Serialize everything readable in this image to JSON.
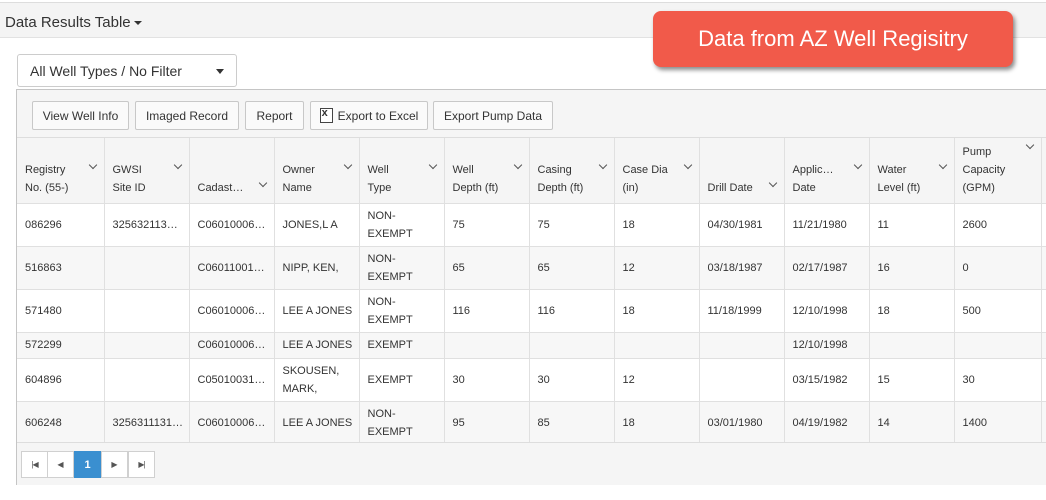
{
  "panel": {
    "title": "Data Results Table"
  },
  "callout": {
    "text": "Data from AZ Well Regisitry",
    "color": "#f15a4a"
  },
  "filter": {
    "selected": "All Well Types / No Filter"
  },
  "toolbar": {
    "view_well_info": "View Well Info",
    "imaged_record": "Imaged Record",
    "report": "Report",
    "export_excel": "Export to Excel",
    "export_pump": "Export Pump Data"
  },
  "columns": [
    "Registry\nNo. (55-)",
    "GWSI\nSite ID",
    "Cadast…",
    "Owner\nName",
    "Well\nType",
    "Well\nDepth (ft)",
    "Casing\nDepth (ft)",
    "Case Dia\n(in)",
    "Drill Date",
    "Applic…\nDate",
    "Water\nLevel (ft)",
    "Pump\nCapacity\n(GPM)"
  ],
  "rows": [
    [
      "086296",
      "325632113…",
      "C06010006…",
      "JONES,L A",
      "NON-\nEXEMPT",
      "75",
      "75",
      "18",
      "04/30/1981",
      "11/21/1980",
      "11",
      "2600"
    ],
    [
      "516863",
      "",
      "C06011001…",
      "NIPP, KEN,",
      "NON-\nEXEMPT",
      "65",
      "65",
      "12",
      "03/18/1987",
      "02/17/1987",
      "16",
      "0"
    ],
    [
      "571480",
      "",
      "C06010006…",
      "LEE A JONES",
      "NON-\nEXEMPT",
      "116",
      "116",
      "18",
      "11/18/1999",
      "12/10/1998",
      "18",
      "500"
    ],
    [
      "572299",
      "",
      "C06010006…",
      "LEE A JONES",
      "EXEMPT",
      "",
      "",
      "",
      "",
      "12/10/1998",
      "",
      ""
    ],
    [
      "604896",
      "",
      "C05010031…",
      "SKOUSEN,\nMARK,",
      "EXEMPT",
      "30",
      "30",
      "12",
      "",
      "03/15/1982",
      "15",
      "30"
    ],
    [
      "606248",
      "3256311131…",
      "C06010006…",
      "LEE A JONES",
      "NON-\nEXEMPT",
      "95",
      "85",
      "18",
      "03/01/1980",
      "04/19/1982",
      "14",
      "1400"
    ]
  ],
  "pager": {
    "current_page": "1"
  },
  "colors": {
    "pager_active": "#3a8fd0"
  }
}
